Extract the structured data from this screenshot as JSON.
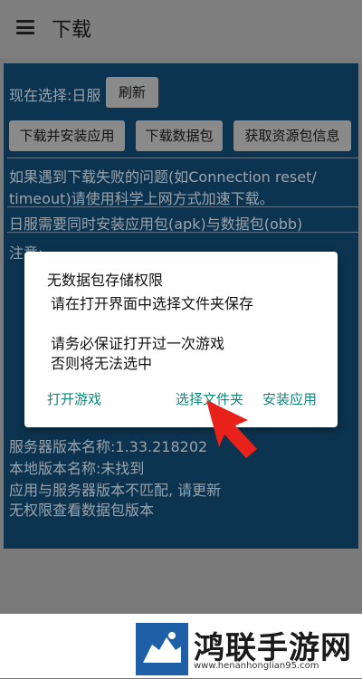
{
  "appbar": {
    "title": "下载"
  },
  "page": {
    "selection_label": "现在选择:日服",
    "refresh_button": "刷新",
    "buttons": [
      "下载并安装应用",
      "下载数据包",
      "获取资源包信息"
    ],
    "notice_line1": "如果遇到下载失败的问题(如Connection reset/",
    "notice_line2": "timeout)请使用科学上网方式加速下载。",
    "japan_note": "日服需要同时安装应用包(apk)与数据包(obb)",
    "notes_label": "注意:",
    "server_version": "服务器版本名称:1.33.218202",
    "local_version": "本地版本名称:未找到",
    "mismatch": "应用与服务器版本不匹配, 请更新",
    "no_permission": "无权限查看数据包版本"
  },
  "dialog": {
    "title": "无数据包存储权限",
    "line1": "请在打开界面中选择文件夹保存",
    "line2": "请务必保证打开过一次游戏",
    "line3": "否则将无法选中",
    "open_game": "打开游戏",
    "select_folder": "选择文件夹",
    "install_app": "安装应用"
  },
  "footer": {
    "brand": "鸿联手游网",
    "url": "www.henanhonglian95.com"
  },
  "colors": {
    "accent": "#0e8a7a",
    "content_bg": "#0c3450",
    "arrow": "#e8221a"
  }
}
